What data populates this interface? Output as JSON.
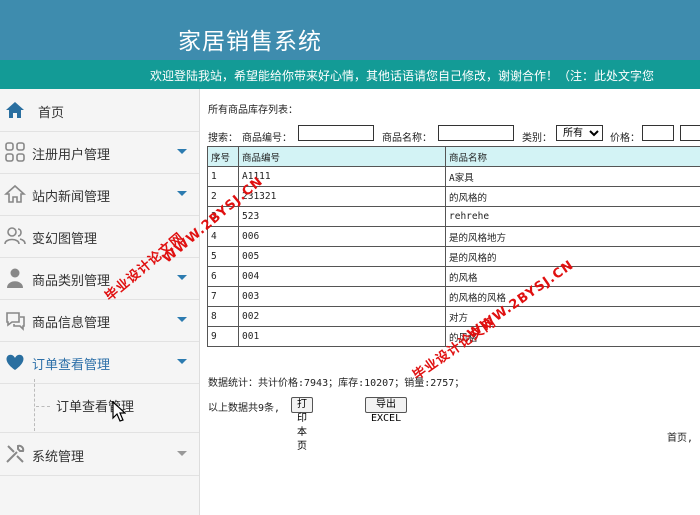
{
  "header": {
    "title": "家居销售系统",
    "marquee": "欢迎登陆我站，希望能给你带来好心情，其他话语请您自己修改，谢谢合作！（注：此处文字您"
  },
  "sidebar": {
    "items": [
      {
        "label": "首页",
        "icon": "home-icon"
      },
      {
        "label": "注册用户管理",
        "icon": "grid-icon"
      },
      {
        "label": "站内新闻管理",
        "icon": "home-icon"
      },
      {
        "label": "变幻图管理",
        "icon": "users-icon"
      },
      {
        "label": "商品类别管理",
        "icon": "user-icon"
      },
      {
        "label": "商品信息管理",
        "icon": "chat-icon"
      },
      {
        "label": "订单查看管理",
        "icon": "heart-icon"
      },
      {
        "label": "系统管理",
        "icon": "tools-icon"
      }
    ],
    "sub_item": "订单查看管理"
  },
  "main": {
    "list_title": "所有商品库存列表：",
    "search": {
      "label": "搜索：",
      "code_label": "商品编号：",
      "name_label": "商品名称：",
      "category_label": "类别：",
      "category_value": "所有",
      "price_label": "价格："
    },
    "table": {
      "headers": [
        "序号",
        "商品编号",
        "商品名称"
      ],
      "rows": [
        [
          "1",
          "A1111",
          "A家具"
        ],
        [
          "2",
          "231321",
          "的风格的"
        ],
        [
          "3",
          "523",
          "rehrehe"
        ],
        [
          "4",
          "006",
          "是的风格地方"
        ],
        [
          "5",
          "005",
          "是的风格的"
        ],
        [
          "6",
          "004",
          "的风格"
        ],
        [
          "7",
          "003",
          "的风格的风格"
        ],
        [
          "8",
          "002",
          "对方"
        ],
        [
          "9",
          "001",
          "的风格"
        ]
      ]
    },
    "stats": "数据统计：共计价格:7943；库存:10207；销量:2757；",
    "footer": {
      "count_text": "以上数据共9条,",
      "print_label": "打印本页",
      "export_label": "导出EXCEL"
    },
    "pager": "首页,"
  },
  "watermarks": {
    "line1": "毕业设计论文网",
    "line2": "WWW.2BYSJ.CN"
  },
  "colors": {
    "header_bg": "#3e8cae",
    "marquee_bg": "#139b96",
    "table_header_bg": "#d3f3f5",
    "accent": "#2c6fa8",
    "watermark": "#e01010"
  }
}
